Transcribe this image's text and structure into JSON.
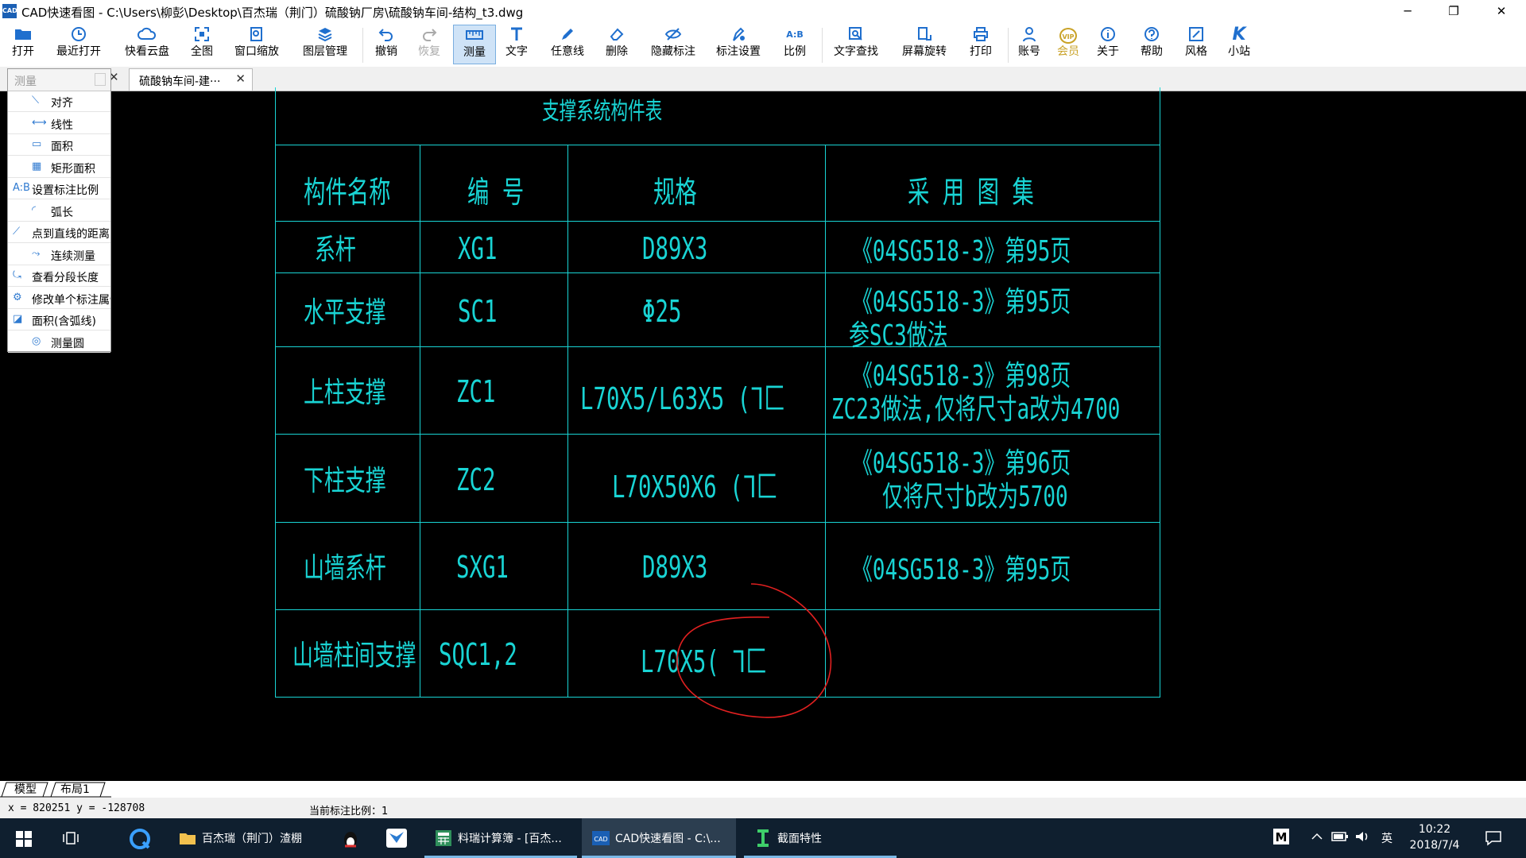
{
  "window": {
    "title": "CAD快速看图 - C:\\Users\\柳彭\\Desktop\\百杰瑞（荆门）硫酸钠厂房\\硫酸钠车间-结构_t3.dwg",
    "app_icon": "CAD",
    "minimize": "─",
    "restore": "❐",
    "close": "✕"
  },
  "toolbar": [
    {
      "label": "打开",
      "icon": "folder-icon"
    },
    {
      "label": "最近打开",
      "icon": "clock-icon"
    },
    {
      "label": "快看云盘",
      "icon": "cloud-icon"
    },
    {
      "label": "全图",
      "icon": "fullview-icon"
    },
    {
      "label": "窗口缩放",
      "icon": "zoom-window-icon"
    },
    {
      "label": "图层管理",
      "icon": "layers-icon"
    },
    {
      "label": "撤销",
      "icon": "undo-icon"
    },
    {
      "label": "恢复",
      "icon": "redo-icon"
    },
    {
      "label": "测量",
      "icon": "measure-icon"
    },
    {
      "label": "文字",
      "icon": "text-icon"
    },
    {
      "label": "任意线",
      "icon": "pen-icon"
    },
    {
      "label": "删除",
      "icon": "eraser-icon"
    },
    {
      "label": "隐藏标注",
      "icon": "eye-off-icon"
    },
    {
      "label": "标注设置",
      "icon": "annotation-settings-icon"
    },
    {
      "label": "比例",
      "icon": "scale-icon"
    },
    {
      "label": "文字查找",
      "icon": "text-search-icon"
    },
    {
      "label": "屏幕旋转",
      "icon": "rotate-icon"
    },
    {
      "label": "打印",
      "icon": "printer-icon"
    },
    {
      "label": "账号",
      "icon": "user-icon"
    },
    {
      "label": "会员",
      "icon": "vip-icon",
      "badge": "VIP"
    },
    {
      "label": "关于",
      "icon": "info-icon"
    },
    {
      "label": "帮助",
      "icon": "help-icon"
    },
    {
      "label": "风格",
      "icon": "style-icon"
    },
    {
      "label": "小站",
      "icon": "k-logo-icon"
    }
  ],
  "tabs": {
    "document": "硫酸钠车间-建···",
    "close_glyph": "✕"
  },
  "measure_panel": {
    "title": "测量",
    "items": [
      "对齐",
      "线性",
      "面积",
      "矩形面积",
      "设置标注比例",
      "弧长",
      "点到直线的距离",
      "连续测量",
      "查看分段长度",
      "修改单个标注属性",
      "面积(含弧线)",
      "测量圆"
    ]
  },
  "drawing": {
    "line_color": "#19d4d4",
    "markup_color": "#e02020",
    "table_title": "支撑系统构件表",
    "headers": [
      "构件名称",
      "编  号",
      "规格",
      "采 用 图 集"
    ],
    "rows": [
      {
        "name": "系杆",
        "code": "XG1",
        "spec": "D89X3",
        "atlas": [
          "《04SG518-3》第95页"
        ]
      },
      {
        "name": "水平支撑",
        "code": "SC1",
        "spec": "Φ25",
        "atlas": [
          "《04SG518-3》第95页",
          "参SC3做法"
        ]
      },
      {
        "name": "上柱支撑",
        "code": "ZC1",
        "spec": "L70X5/L63X5  (ᒣ匚",
        "atlas": [
          "《04SG518-3》第98页",
          "ZC23做法,仅将尺寸a改为4700"
        ]
      },
      {
        "name": "下柱支撑",
        "code": "ZC2",
        "spec": "L70X50X6 (ᒣ匚",
        "atlas": [
          "《04SG518-3》第96页",
          "仅将尺寸b改为5700"
        ]
      },
      {
        "name": "山墙系杆",
        "code": "SXG1",
        "spec": "D89X3",
        "atlas": [
          "《04SG518-3》第95页"
        ]
      },
      {
        "name": "山墙柱间支撑",
        "code": "SQC1,2",
        "spec": "L70X5( ᒣ匚",
        "atlas": []
      }
    ]
  },
  "layout_tabs": [
    "模型",
    "布局1"
  ],
  "status": {
    "coords": "x = 820251  y = -128708",
    "scale": "当前标注比例：1"
  },
  "taskbar": {
    "apps": [
      {
        "label": "百杰瑞（荆门）渣棚",
        "icon": "folder-icon"
      },
      {
        "label": "料瑞计算簿 - [百杰...",
        "icon": "calculator-icon"
      },
      {
        "label": "CAD快速看图 - C:\\...",
        "icon": "cad-icon"
      },
      {
        "label": "截面特性",
        "icon": "section-icon"
      }
    ],
    "tray": {
      "ime": "英",
      "time": "10:22",
      "date": "2018/7/4"
    }
  }
}
